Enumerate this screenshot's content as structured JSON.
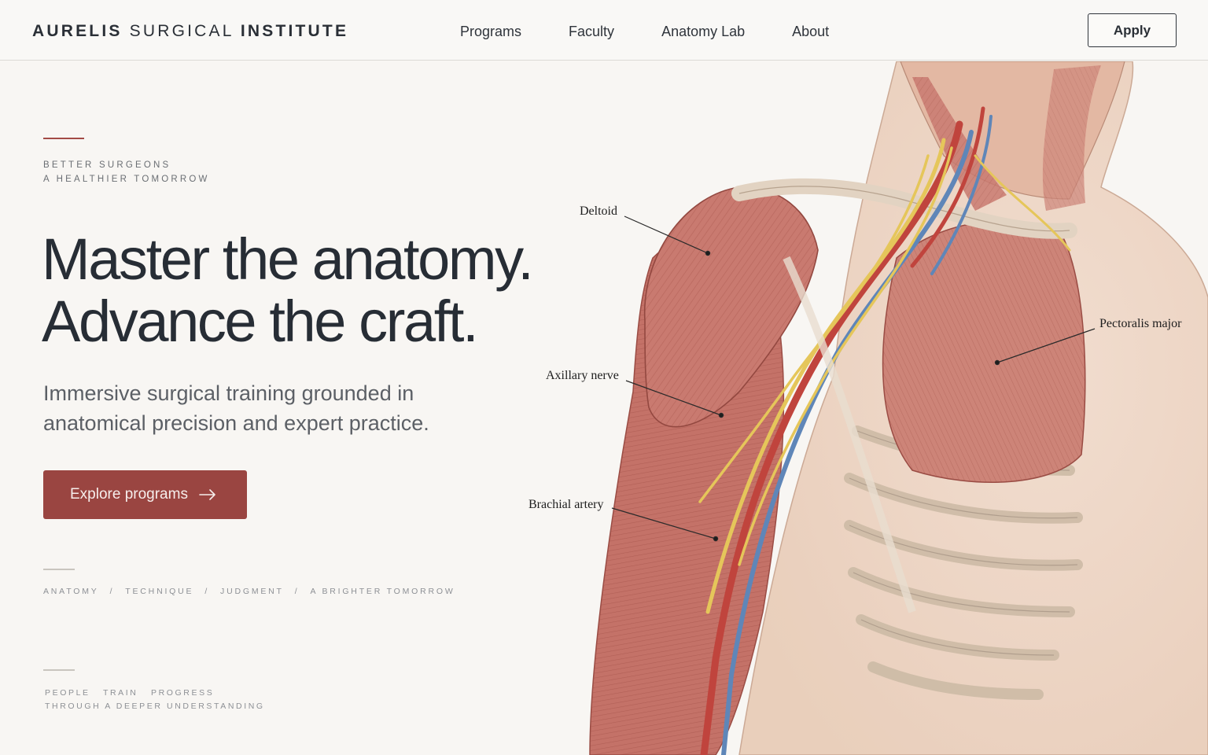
{
  "header": {
    "brand": {
      "first": "AURELIS",
      "middle": "SURGICAL",
      "last": "INSTITUTE"
    },
    "nav": [
      {
        "label": "Programs"
      },
      {
        "label": "Faculty"
      },
      {
        "label": "Anatomy Lab"
      },
      {
        "label": "About"
      }
    ],
    "apply_label": "Apply"
  },
  "hero": {
    "tagline": [
      "BETTER SURGEONS",
      "A HEALTHIER TOMORROW"
    ],
    "headline": [
      "Master the anatomy.",
      "Advance the craft."
    ],
    "subheadline": "Immersive surgical training grounded in anatomical precision and expert practice.",
    "cta_label": "Explore programs",
    "cta_icon": "arrow-right-icon",
    "pillars": [
      "ANATOMY",
      "TECHNIQUE",
      "JUDGMENT",
      "A BRIGHTER TOMORROW"
    ],
    "pillar_separator": "/",
    "footnote": {
      "line1": [
        "PEOPLE",
        "TRAIN",
        "PROGRESS"
      ],
      "line2": "THROUGH A DEEPER UNDERSTANDING"
    }
  },
  "illustration": {
    "labels": {
      "deltoid": "Deltoid",
      "pectoralis": "Pectoralis major",
      "axillary": "Axillary nerve",
      "brachial": "Brachial artery"
    }
  },
  "colors": {
    "accent": "#9a4541",
    "accent_rule": "#a34b46",
    "text_dark": "#272d35",
    "background": "#f8f6f3",
    "muscle": "#c97a70",
    "nerve": "#e5c65a",
    "vein": "#5f86b8",
    "artery": "#c0443d"
  }
}
